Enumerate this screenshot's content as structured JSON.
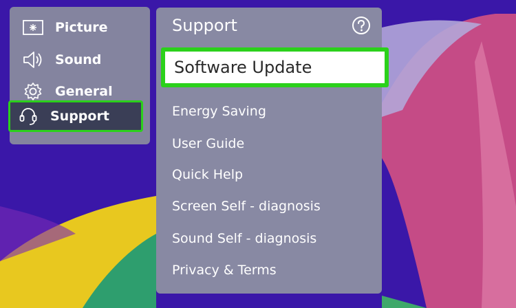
{
  "left_menu": {
    "items": [
      {
        "label": "Picture",
        "icon": "picture-icon"
      },
      {
        "label": "Sound",
        "icon": "speaker-icon"
      },
      {
        "label": "General",
        "icon": "gear-icon"
      },
      {
        "label": "Support",
        "icon": "headset-icon",
        "selected": true
      }
    ]
  },
  "support_panel": {
    "title": "Support",
    "help_icon": "help-icon",
    "items": [
      {
        "label": "Software Update",
        "focused": true
      },
      {
        "label": "Energy Saving"
      },
      {
        "label": "User Guide"
      },
      {
        "label": "Quick Help"
      },
      {
        "label": "Screen Self - diagnosis"
      },
      {
        "label": "Sound Self - diagnosis"
      },
      {
        "label": "Privacy & Terms"
      }
    ]
  },
  "colors": {
    "focus_outline": "#2bd11b",
    "background": "#3a17a8"
  }
}
